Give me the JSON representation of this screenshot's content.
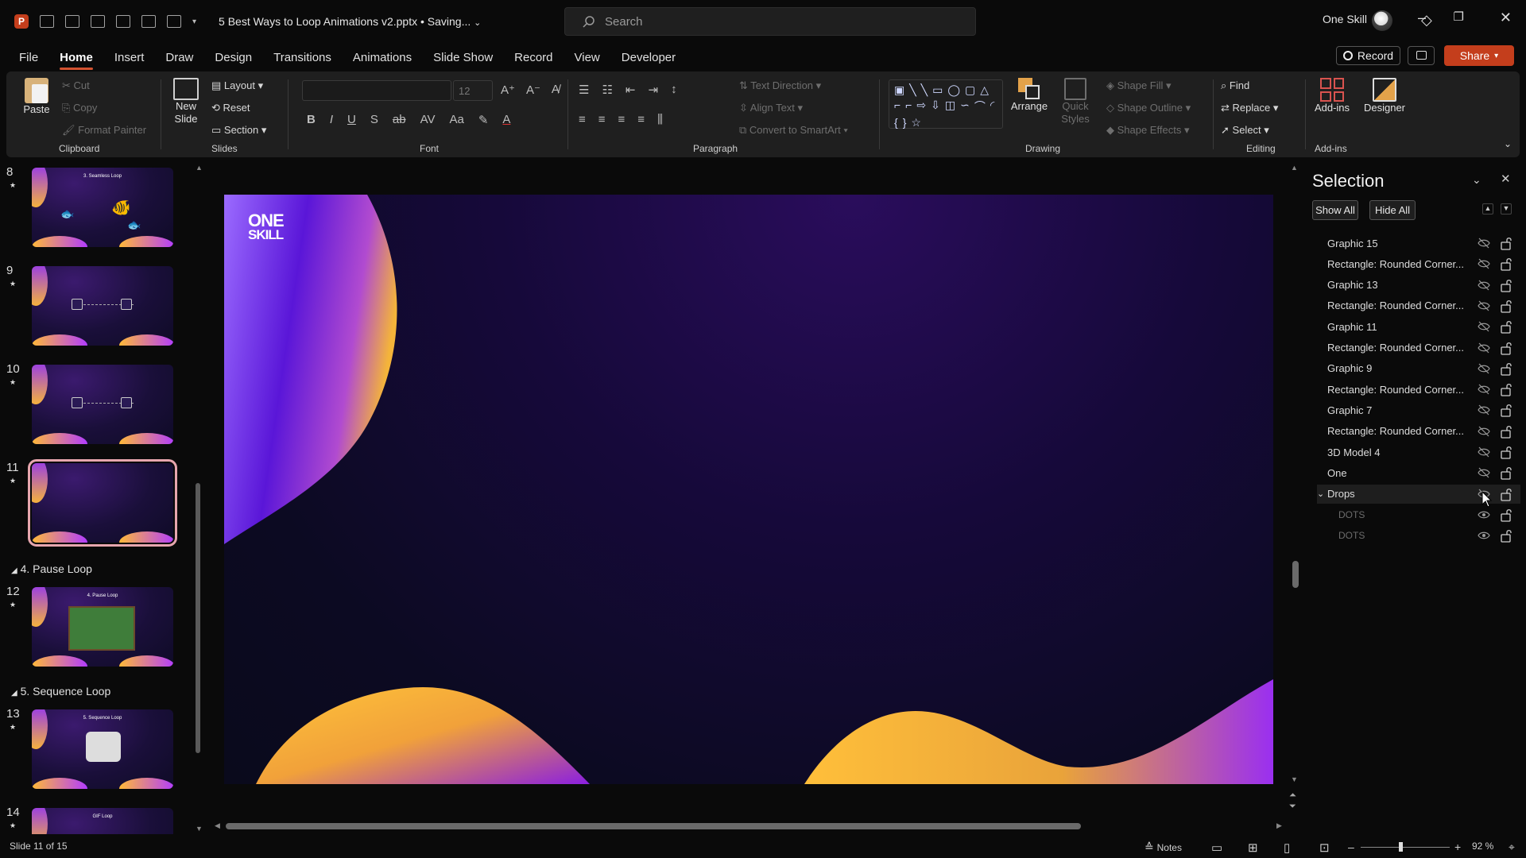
{
  "app": {
    "logo_letter": "P",
    "doc_title": "5 Best Ways to Loop Animations v2.pptx • Saving...",
    "search_placeholder": "Search",
    "account": "One Skill",
    "accent": "#c43e1c"
  },
  "window": {
    "minimize": "–",
    "restore": "❐",
    "close": "✕"
  },
  "menu": [
    "File",
    "Home",
    "Insert",
    "Draw",
    "Design",
    "Transitions",
    "Animations",
    "Slide Show",
    "Record",
    "View",
    "Developer"
  ],
  "toolbar_right": {
    "record": "Record",
    "share": "Share"
  },
  "ribbon": {
    "clipboard": {
      "label": "Clipboard",
      "paste": "Paste",
      "cut": "Cut",
      "copy": "Copy",
      "format_painter": "Format Painter"
    },
    "slides": {
      "label": "Slides",
      "new_slide": "New Slide",
      "layout": "Layout",
      "reset": "Reset",
      "section": "Section"
    },
    "font": {
      "label": "Font",
      "size": "12"
    },
    "paragraph": {
      "label": "Paragraph",
      "text_direction": "Text Direction",
      "align_text": "Align Text",
      "convert_smartart": "Convert to SmartArt"
    },
    "drawing": {
      "label": "Drawing",
      "arrange": "Arrange",
      "quick_styles": "Quick Styles",
      "shape_fill": "Shape Fill",
      "shape_outline": "Shape Outline",
      "shape_effects": "Shape Effects"
    },
    "editing": {
      "label": "Editing",
      "find": "Find",
      "replace": "Replace",
      "select": "Select"
    },
    "addins": {
      "label": "Add-ins",
      "addins": "Add-ins",
      "designer": "Designer"
    }
  },
  "thumbnails": {
    "slides": [
      {
        "num": "8",
        "title": "3. Seamless Loop"
      },
      {
        "num": "9",
        "title": ""
      },
      {
        "num": "10",
        "title": ""
      },
      {
        "num": "11",
        "title": ""
      },
      {
        "num": "12",
        "title": "4. Pause Loop"
      },
      {
        "num": "13",
        "title": "5. Sequence Loop"
      },
      {
        "num": "14",
        "title": "GIF Loop"
      }
    ],
    "sections": [
      "4. Pause Loop",
      "5. Sequence Loop"
    ],
    "selected": "11"
  },
  "slide": {
    "logo_line1": "ONE",
    "logo_line2": "SKILL"
  },
  "selection_pane": {
    "title": "Selection",
    "show_all": "Show All",
    "hide_all": "Hide All",
    "items": [
      {
        "name": "Graphic 15",
        "visible": false
      },
      {
        "name": "Rectangle: Rounded Corner...",
        "visible": false
      },
      {
        "name": "Graphic 13",
        "visible": false
      },
      {
        "name": "Rectangle: Rounded Corner...",
        "visible": false
      },
      {
        "name": "Graphic 11",
        "visible": false
      },
      {
        "name": "Rectangle: Rounded Corner...",
        "visible": false
      },
      {
        "name": "Graphic 9",
        "visible": false
      },
      {
        "name": "Rectangle: Rounded Corner...",
        "visible": false
      },
      {
        "name": "Graphic 7",
        "visible": false
      },
      {
        "name": "Rectangle: Rounded Corner...",
        "visible": false
      },
      {
        "name": "3D Model 4",
        "visible": false
      },
      {
        "name": "One",
        "visible": false
      },
      {
        "name": "Drops",
        "visible": false,
        "group": true
      },
      {
        "name": "DOTS",
        "visible": true,
        "child": true
      },
      {
        "name": "DOTS",
        "visible": true,
        "child": true
      }
    ]
  },
  "status": {
    "slide_info": "Slide 11 of 15",
    "notes": "Notes",
    "zoom": "92 %"
  }
}
